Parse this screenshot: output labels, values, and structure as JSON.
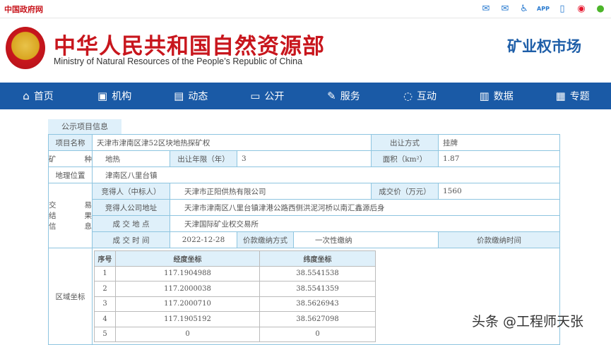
{
  "topbar": {
    "gov_link": "中国政府网",
    "icons": [
      "mail-icon",
      "mail-send-icon",
      "accessibility-icon",
      "app-icon",
      "mobile-icon",
      "weibo-icon",
      "wechat-icon"
    ]
  },
  "header": {
    "title": "中华人民共和国自然资源部",
    "subtitle": "Ministry of Natural Resources of the People’s Republic of China",
    "market": "矿业权市场"
  },
  "nav": [
    {
      "icon": "home-icon",
      "g": "⌂",
      "label": "首页"
    },
    {
      "icon": "org-icon",
      "g": "▣",
      "label": "机构"
    },
    {
      "icon": "news-icon",
      "g": "▤",
      "label": "动态"
    },
    {
      "icon": "public-icon",
      "g": "▭",
      "label": "公开"
    },
    {
      "icon": "service-icon",
      "g": "✎",
      "label": "服务"
    },
    {
      "icon": "chat-icon",
      "g": "◌",
      "label": "互动"
    },
    {
      "icon": "data-icon",
      "g": "▥",
      "label": "数据"
    },
    {
      "icon": "topic-icon",
      "g": "▦",
      "label": "专题"
    }
  ],
  "tab": "公示项目信息",
  "info": {
    "project_name_label": "项目名称",
    "project_name": "天津市津南区津52区块地热探矿权",
    "transfer_method_label": "出让方式",
    "transfer_method": "挂牌",
    "mineral_label_a": "矿",
    "mineral_label_b": "种",
    "mineral": "地热",
    "term_label": "出让年限（年）",
    "term": "3",
    "area_label": "面积（km²）",
    "area": "1.87",
    "location_label": "地理位置",
    "location": "津南区八里台镇",
    "trade_label": [
      "交",
      "易",
      "结",
      "果",
      "信",
      "息"
    ],
    "winner_label": "竞得人（中标人）",
    "winner": "天津市正阳供热有限公司",
    "price_label": "成交价（万元）",
    "price": "1560",
    "winner_addr_label": "竞得人公司地址",
    "winner_addr": "天津市津南区八里台镇津港公路西侧洪泥河桥以南汇鑫源后身",
    "deal_place_label": "成 交 地 点",
    "deal_place": "天津国际矿业权交易所",
    "deal_time_label": "成 交 时 间",
    "deal_time": "2022-12-28",
    "pay_method_label": "价款缴纳方式",
    "pay_method": "一次性缴纳",
    "pay_time_label": "价款缴纳时间",
    "pay_time": "",
    "coords_label": "区域坐标"
  },
  "coords": {
    "headers": [
      "序号",
      "经度坐标",
      "纬度坐标"
    ],
    "rows": [
      [
        "1",
        "117.1904988",
        "38.5541538"
      ],
      [
        "2",
        "117.2000038",
        "38.5541359"
      ],
      [
        "3",
        "117.2000710",
        "38.5626943"
      ],
      [
        "4",
        "117.1905192",
        "38.5627098"
      ],
      [
        "5",
        "0",
        "0"
      ]
    ]
  },
  "watermark": "头条 @工程师天张"
}
